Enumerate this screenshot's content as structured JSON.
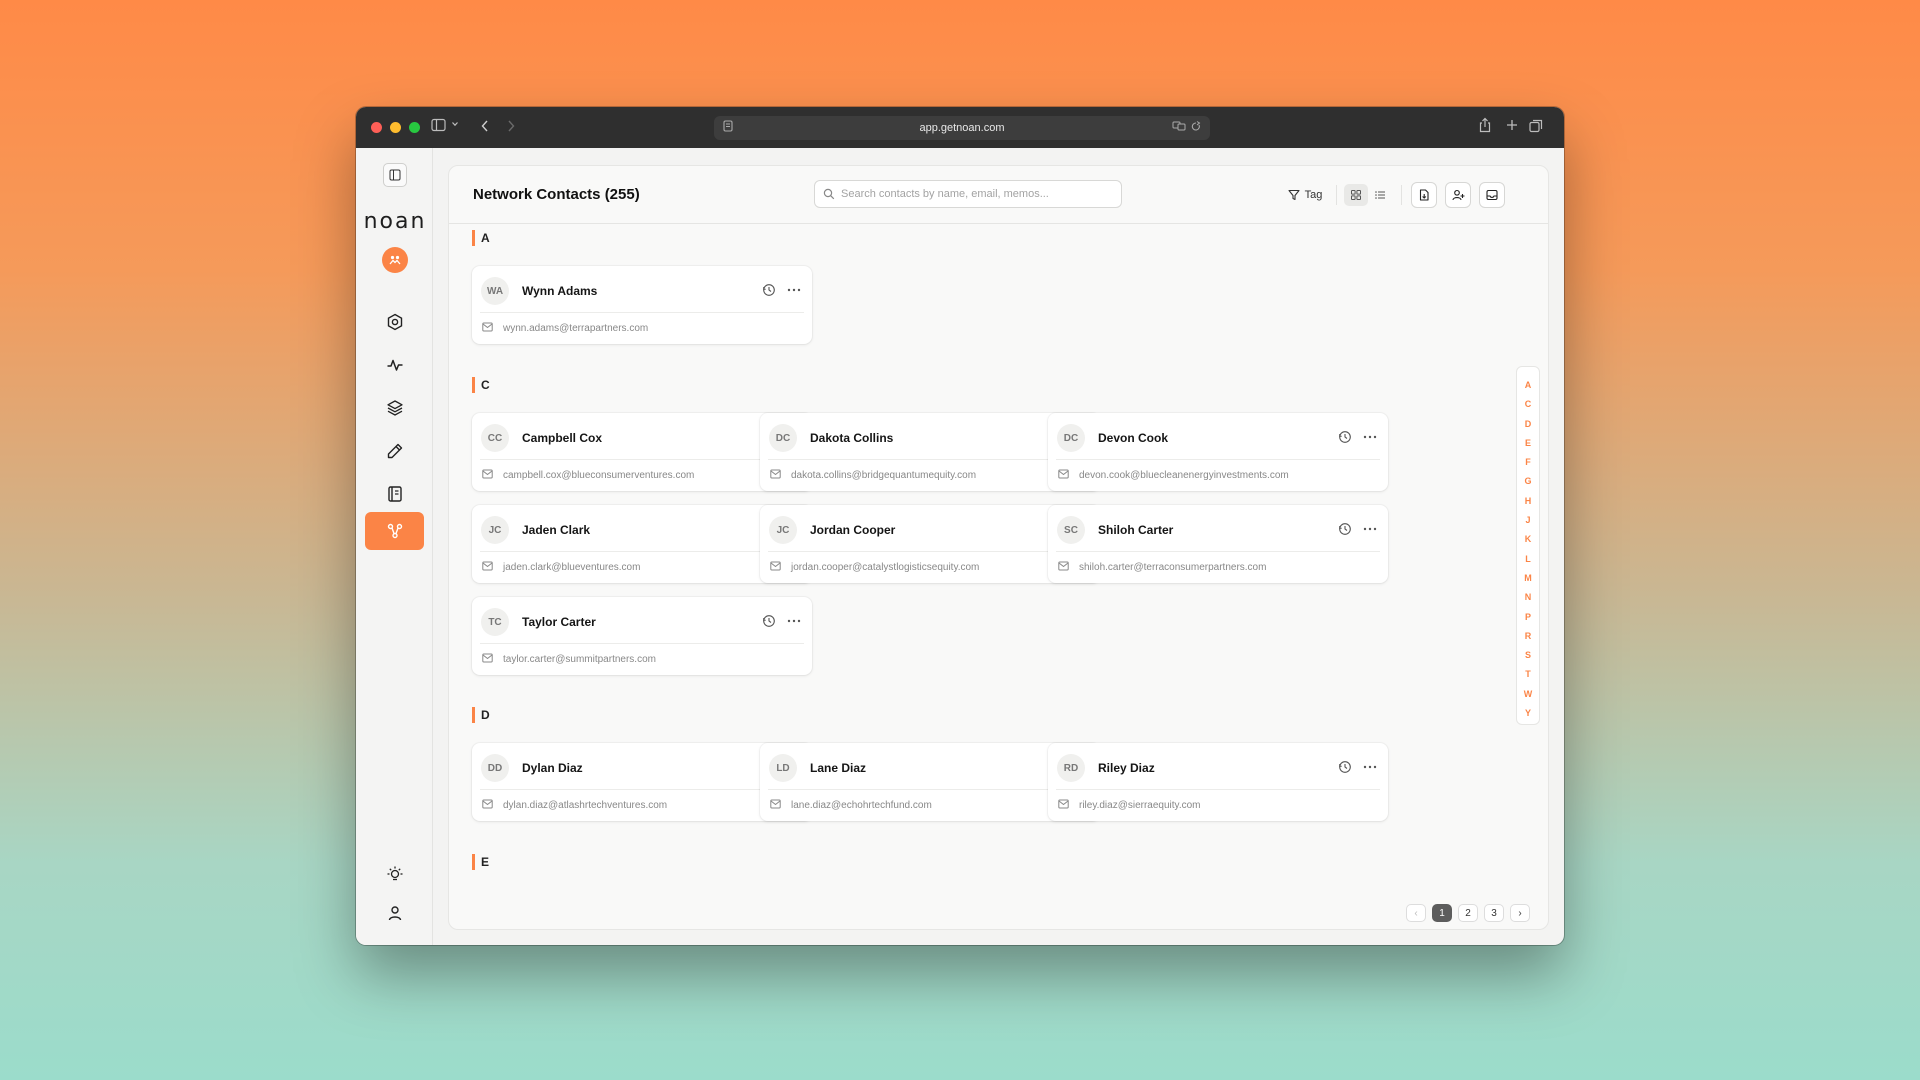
{
  "browser": {
    "url": "app.getnoan.com"
  },
  "sidebar": {
    "logo": "noan",
    "icons": [
      "hexagon-icon",
      "activity-icon",
      "layers-icon",
      "pen-icon",
      "notebook-icon",
      "network-icon"
    ],
    "active_item": "network-icon",
    "bottom_icons": [
      "lightbulb-icon",
      "user-icon"
    ]
  },
  "header": {
    "title": "Network Contacts (255)",
    "search_placeholder": "Search contacts by name, email, memos...",
    "tag_label": "Tag"
  },
  "groups": [
    {
      "letter": "A",
      "contacts": [
        {
          "initials": "WA",
          "name": "Wynn Adams",
          "email": "wynn.adams@terrapartners.com"
        }
      ]
    },
    {
      "letter": "C",
      "contacts": [
        {
          "initials": "CC",
          "name": "Campbell Cox",
          "email": "campbell.cox@blueconsumerventures.com"
        },
        {
          "initials": "DC",
          "name": "Dakota Collins",
          "email": "dakota.collins@bridgequantumequity.com"
        },
        {
          "initials": "DC",
          "name": "Devon Cook",
          "email": "devon.cook@bluecleanenergyinvestments.com"
        },
        {
          "initials": "JC",
          "name": "Jaden Clark",
          "email": "jaden.clark@blueventures.com"
        },
        {
          "initials": "JC",
          "name": "Jordan Cooper",
          "email": "jordan.cooper@catalystlogisticsequity.com"
        },
        {
          "initials": "SC",
          "name": "Shiloh Carter",
          "email": "shiloh.carter@terraconsumerpartners.com"
        },
        {
          "initials": "TC",
          "name": "Taylor Carter",
          "email": "taylor.carter@summitpartners.com"
        }
      ]
    },
    {
      "letter": "D",
      "contacts": [
        {
          "initials": "DD",
          "name": "Dylan Diaz",
          "email": "dylan.diaz@atlashrtechventures.com"
        },
        {
          "initials": "LD",
          "name": "Lane Diaz",
          "email": "lane.diaz@echohrtechfund.com"
        },
        {
          "initials": "RD",
          "name": "Riley Diaz",
          "email": "riley.diaz@sierraequity.com"
        }
      ]
    },
    {
      "letter": "E",
      "contacts": []
    }
  ],
  "alphabet": [
    "A",
    "C",
    "D",
    "E",
    "F",
    "G",
    "H",
    "J",
    "K",
    "L",
    "M",
    "N",
    "P",
    "R",
    "S",
    "T",
    "W",
    "Y"
  ],
  "pagination": {
    "pages": [
      "1",
      "2",
      "3"
    ],
    "current": "1",
    "prev": "‹",
    "next": "›"
  },
  "colors": {
    "accent": "#fb8446",
    "window_chrome": "#2f2f2f"
  }
}
